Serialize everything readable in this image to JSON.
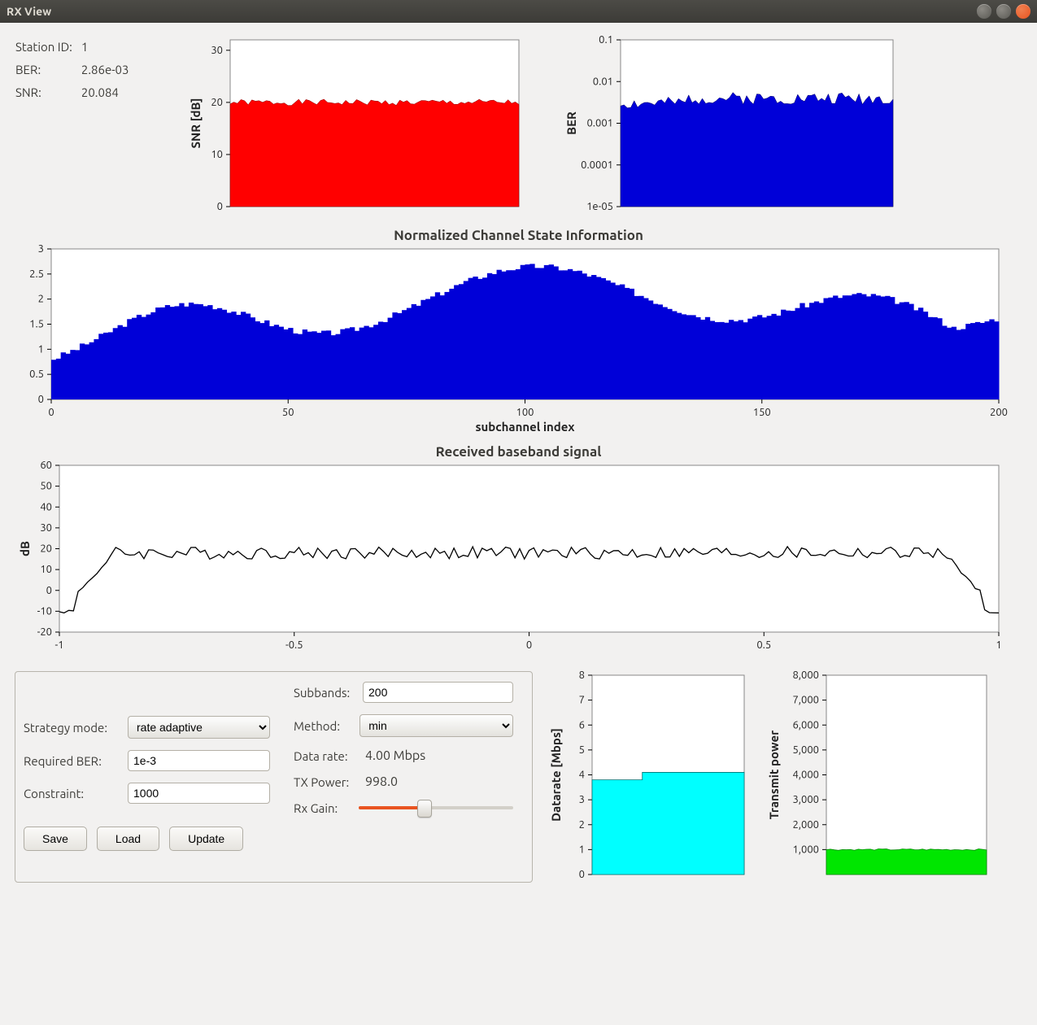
{
  "window": {
    "title": "RX View"
  },
  "status": {
    "station_label": "Station ID:",
    "station_value": "1",
    "ber_label": "BER:",
    "ber_value": "2.86e-03",
    "snr_label": "SNR:",
    "snr_value": "20.084"
  },
  "titles": {
    "csi": "Normalized Channel State Information",
    "baseband": "Received baseband signal"
  },
  "axes": {
    "snr_y": "SNR [dB]",
    "ber_y": "BER",
    "csi_x": "subchannel index",
    "baseband_y": "dB",
    "datarate_y": "Datarate [Mbps]",
    "txpower_y": "Transmit power"
  },
  "controls": {
    "strategy_label": "Strategy mode:",
    "strategy_value": "rate adaptive",
    "required_ber_label": "Required BER:",
    "required_ber_value": "1e-3",
    "constraint_label": "Constraint:",
    "constraint_value": "1000",
    "subbands_label": "Subbands:",
    "subbands_value": "200",
    "method_label": "Method:",
    "method_value": "min",
    "datarate_label": "Data rate:",
    "datarate_value": "4.00 Mbps",
    "txpower_label": "TX Power:",
    "txpower_value": "998.0",
    "rxgain_label": "Rx Gain:",
    "rxgain_fraction": 0.42,
    "buttons": {
      "save": "Save",
      "load": "Load",
      "update": "Update"
    }
  },
  "chart_data": [
    {
      "id": "snr",
      "type": "area",
      "ylabel": "SNR [dB]",
      "yticks": [
        0,
        10,
        20,
        30
      ],
      "ylim": [
        0,
        32
      ],
      "x": [
        0,
        200
      ],
      "value_mean": 20.0,
      "value_jitter": 0.6,
      "color": "#ff0000"
    },
    {
      "id": "ber",
      "type": "area-log",
      "ylabel": "BER",
      "yticks": [
        "1e-05",
        "0.0001",
        "0.001",
        "0.01",
        "0.1"
      ],
      "ylog_range": [
        -5,
        -1
      ],
      "x": [
        0,
        200
      ],
      "value_mean": 0.003,
      "value_jitter_log": 0.15,
      "bump_start": 0.25,
      "bump_level": 0.004,
      "color": "#0000d8"
    },
    {
      "id": "csi",
      "type": "bar",
      "title": "Normalized Channel State Information",
      "xlabel": "subchannel index",
      "xticks": [
        0,
        50,
        100,
        150,
        200
      ],
      "yticks": [
        0,
        0.5,
        1,
        1.5,
        2,
        2.5,
        3
      ],
      "ylim": [
        0,
        3
      ],
      "n": 200,
      "shape": {
        "baseline": 0.45,
        "peaks": [
          {
            "center": 28,
            "height": 1.4,
            "width": 24
          },
          {
            "center": 102,
            "height": 2.2,
            "width": 38
          },
          {
            "center": 172,
            "height": 1.55,
            "width": 26
          }
        ],
        "right_rise": 0.7
      },
      "color": "#0000d8"
    },
    {
      "id": "baseband",
      "type": "line",
      "title": "Received baseband signal",
      "ylabel": "dB",
      "xticks": [
        -1,
        -0.5,
        0,
        0.5,
        1
      ],
      "yticks": [
        -20,
        -10,
        0,
        10,
        20,
        30,
        40,
        50,
        60
      ],
      "xlim": [
        -1,
        1
      ],
      "ylim": [
        -20,
        60
      ],
      "shape": {
        "edge_level": -10,
        "transition_width": 0.12,
        "plateau_level": 18,
        "plateau_jitter": 3
      },
      "color": "#000000"
    },
    {
      "id": "datarate",
      "type": "area",
      "ylabel": "Datarate [Mbps]",
      "yticks": [
        0,
        1,
        2,
        3,
        4,
        5,
        6,
        7,
        8
      ],
      "ylim": [
        0,
        8
      ],
      "value_left": 3.8,
      "value_right": 4.1,
      "step_at": 0.33,
      "color": "#00ffff"
    },
    {
      "id": "txpower",
      "type": "area",
      "ylabel": "Transmit power",
      "yticks": [
        1000,
        2000,
        3000,
        4000,
        5000,
        6000,
        7000,
        8000
      ],
      "ytick_labels": [
        "1,000",
        "2,000",
        "3,000",
        "4,000",
        "5,000",
        "6,000",
        "7,000",
        "8,000"
      ],
      "ylim": [
        0,
        8000
      ],
      "value_mean": 1000,
      "color": "#00e600"
    }
  ]
}
